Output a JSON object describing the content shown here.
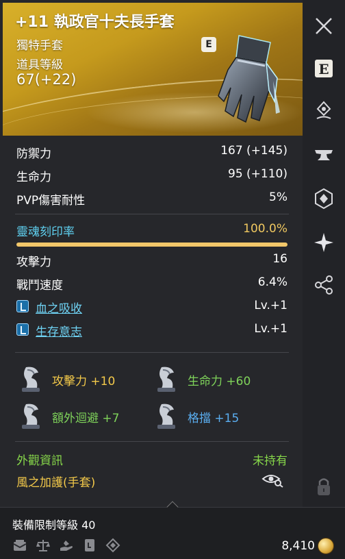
{
  "item": {
    "title": "+11 執政官十夫長手套",
    "type": "獨特手套",
    "level_label": "道具等級",
    "level_value": "67(+22)",
    "grade_badge": "E"
  },
  "sidebar": {
    "close_icon": "close-icon",
    "items": [
      {
        "name": "enchant-e-icon",
        "glyph": "E"
      },
      {
        "name": "pin-icon"
      },
      {
        "name": "anvil-icon"
      },
      {
        "name": "rune-shield-icon"
      },
      {
        "name": "star-burst-icon"
      },
      {
        "name": "share-icon"
      },
      {
        "name": "lock-icon"
      }
    ]
  },
  "stats": [
    {
      "label": "防禦力",
      "value": "167 (+145)"
    },
    {
      "label": "生命力",
      "value": "95 (+110)"
    },
    {
      "label": "PVP傷害耐性",
      "value": "5%"
    }
  ],
  "soul": {
    "label": "靈魂刻印率",
    "value": "100.0%",
    "fill_percent": 100
  },
  "attributes": [
    {
      "label": "攻擊力",
      "value": "16"
    },
    {
      "label": "戰鬥速度",
      "value": "6.4%"
    }
  ],
  "skills": [
    {
      "label": "血之吸收",
      "value": "Lv.+1"
    },
    {
      "label": "生存意志",
      "value": "Lv.+1"
    }
  ],
  "crystals": [
    {
      "name": "攻擊力",
      "bonus": "+10",
      "color": "#f3c94a"
    },
    {
      "name": "生命力",
      "bonus": "+60",
      "color": "#7fd35a"
    },
    {
      "name": "額外迴避",
      "bonus": "+7",
      "color": "#7fd35a"
    },
    {
      "name": "格擋",
      "bonus": "+15",
      "color": "#5aaef0"
    }
  ],
  "appearance": {
    "label": "外觀資訊",
    "status": "未持有",
    "skin_name": "風之加護(手套)"
  },
  "footer": {
    "required_level": "裝備限制等級 40",
    "price": "8,410",
    "icons": [
      "storage-icon",
      "scale-icon",
      "hand-trade-icon",
      "book-icon",
      "diamond-icon"
    ]
  },
  "colors": {
    "header_gold": "#d8b02a",
    "soul_label": "#5fd0f0",
    "soul_value": "#f0c860",
    "green": "#86d64a",
    "blue": "#5aaef0"
  }
}
